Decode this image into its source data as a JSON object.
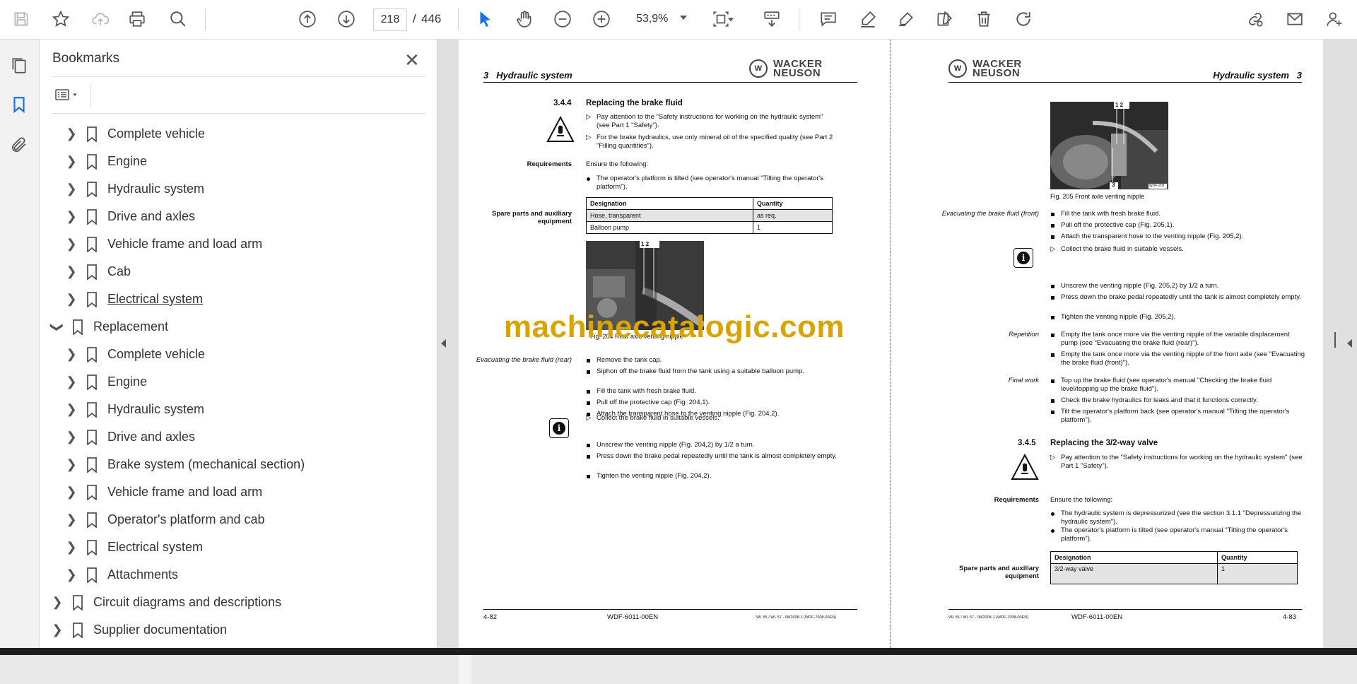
{
  "toolbar": {
    "page_current": "218",
    "page_separator": "/",
    "page_total": "446",
    "zoom": "53,9%"
  },
  "bookmarks": {
    "title": "Bookmarks",
    "items": [
      {
        "label": "Complete vehicle"
      },
      {
        "label": "Engine"
      },
      {
        "label": "Hydraulic system"
      },
      {
        "label": "Drive and axles"
      },
      {
        "label": "Vehicle frame and load arm"
      },
      {
        "label": "Cab"
      },
      {
        "label": "Electrical system"
      },
      {
        "label": "Replacement"
      },
      {
        "label": "Complete vehicle"
      },
      {
        "label": "Engine"
      },
      {
        "label": "Hydraulic system"
      },
      {
        "label": "Drive and axles"
      },
      {
        "label": "Brake system (mechanical section)"
      },
      {
        "label": "Vehicle frame and load arm"
      },
      {
        "label": "Operator's platform and cab"
      },
      {
        "label": "Electrical system"
      },
      {
        "label": "Attachments"
      },
      {
        "label": "Circuit diagrams and descriptions"
      },
      {
        "label": "Supplier documentation"
      }
    ]
  },
  "left_page": {
    "header_num": "3",
    "header_title": "Hydraulic system",
    "logo_line1": "WACKER",
    "logo_line2": "NEUSON",
    "section_num": "3.4.4",
    "section_title": "Replacing the brake fluid",
    "warn_1": "Pay attention to the \"Safety instructions for working on the hydraulic system\" (see Part 1 \"Safety\").",
    "warn_2": "For the brake hydraulics, use only mineral oil of the specified quality (see Part 2 \"Filling quantities\").",
    "req_label": "Requirements",
    "req_intro": "Ensure the following:",
    "req_1": "The operator's platform is tilted (see operator's manual \"Tilting the operator's platform\").",
    "spare_label": "Spare parts and auxiliary equipment",
    "table_h1": "Designation",
    "table_h2": "Quantity",
    "row1_a": "Hose, transparent",
    "row1_b": "as req.",
    "row2_a": "Balloon pump",
    "row2_b": "1",
    "fig_caption": "Fig. 204 Rear axle venting nipple",
    "fig_marks": "1 2",
    "evac_label": "Evacuating the brake fluid (rear)",
    "steps": [
      "Remove the tank cap.",
      "Siphon off the brake fluid from the tank using a suitable balloon pump.",
      "Fill the tank with fresh brake fluid.",
      "Pull off the protective cap (Fig. 204,1).",
      "Attach the transparent hose to the venting nipple (Fig. 204,2)."
    ],
    "collect": "Collect the brake fluid in suitable vessels.",
    "steps2": [
      "Unscrew the venting nipple (Fig. 204,2) by 1/2 a turn.",
      "Press down the brake pedal repeatedly until the tank is almost completely empty.",
      "Tighten the venting nipple (Fig. 204,2)."
    ],
    "footer_page": "4-82",
    "footer_doc": "WDF-6011-00EN",
    "footer_small": "WL 55 / WL 57 - 08/2008-1 (WDF-7008-00EN)"
  },
  "right_page": {
    "header_num": "3",
    "header_title": "Hydraulic system",
    "logo_line1": "WACKER",
    "logo_line2": "NEUSON",
    "fig_caption": "Fig. 205   Front axle venting nipple",
    "fig_marks": "1 2",
    "fig_mark3": "3",
    "fig_code": "WDF-205",
    "evac_label": "Evacuating the brake fluid (front)",
    "steps": [
      "Fill the tank with fresh brake fluid.",
      "Pull off the protective cap (Fig. 205,1).",
      "Attach the transparent hose to the venting nipple (Fig. 205,2)."
    ],
    "collect": "Collect the brake fluid in suitable vessels.",
    "steps2": [
      "Unscrew the venting nipple (Fig. 205,2) by 1/2 a turn.",
      "Press down the brake pedal repeatedly until the tank is almost completely empty.",
      "Tighten the venting nipple (Fig. 205,2)."
    ],
    "rep_label": "Repetition",
    "rep_1": "Empty the tank once more via the venting nipple of the variable displacement pump (see \"Evacuating the brake fluid (rear)\").",
    "rep_2": "Empty the tank once more via the venting nipple of the front axle (see \"Evacuating the brake fluid (front)\").",
    "final_label": "Final work",
    "final_1": "Top up the brake fluid (see operator's manual \"Checking the brake fluid level/topping up the brake fluid\").",
    "final_2": "Check the brake hydraulics for leaks and that it functions correctly.",
    "final_3": "Tilt the operator's platform back (see operator's manual \"Tilting the operator's platform\").",
    "section_num": "3.4.5",
    "section_title": "Replacing the 3/2-way valve",
    "warn_1": "Pay attention to the \"Safety instructions for working on the hydraulic system\" (see Part 1 \"Safety\").",
    "req_label": "Requirements",
    "req_intro": "Ensure the following:",
    "req_1": "The hydraulic system is depressurized (see the section 3.1.1 \"Depressurizing the hydraulic system\").",
    "req_2": "The operator's platform is tilted (see operator's manual \"Tilting the operator's platform\").",
    "spare_label": "Spare parts and auxiliary equipment",
    "table_h1": "Designation",
    "table_h2": "Quantity",
    "row1_a": "3/2-way valve",
    "row1_b": "1",
    "footer_page": "4-83",
    "footer_doc": "WDF-6011-00EN",
    "footer_small": "WL 55 / WL 57 - 08/2008-1 (WDF-7008-00EN)"
  },
  "watermark": "machinecatalogic.com"
}
